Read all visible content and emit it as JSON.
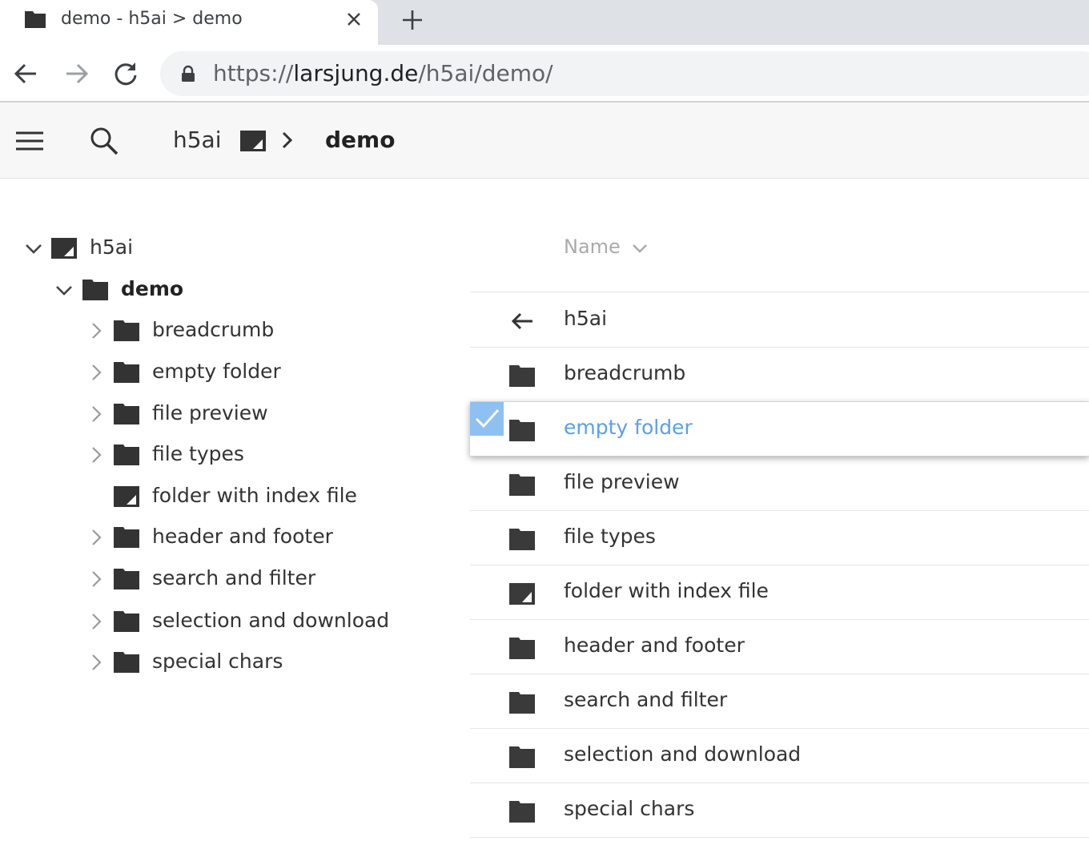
{
  "browser": {
    "tab_title": "demo - h5ai > demo",
    "url_scheme": "https://",
    "url_host": "larsjung.de",
    "url_path": "/h5ai/demo/"
  },
  "topbar": {
    "crumb_root": "h5ai",
    "crumb_current": "demo"
  },
  "tree": {
    "root": "h5ai",
    "current": "demo",
    "children": [
      {
        "label": "breadcrumb",
        "has_children": true,
        "icon": "folder-icon"
      },
      {
        "label": "empty folder",
        "has_children": true,
        "icon": "folder-icon"
      },
      {
        "label": "file preview",
        "has_children": true,
        "icon": "folder-icon"
      },
      {
        "label": "file types",
        "has_children": true,
        "icon": "folder-icon"
      },
      {
        "label": "folder with index file",
        "has_children": false,
        "icon": "folder-page-icon"
      },
      {
        "label": "header and footer",
        "has_children": true,
        "icon": "folder-icon"
      },
      {
        "label": "search and filter",
        "has_children": true,
        "icon": "folder-icon"
      },
      {
        "label": "selection and download",
        "has_children": true,
        "icon": "folder-icon"
      },
      {
        "label": "special chars",
        "has_children": true,
        "icon": "folder-icon"
      }
    ]
  },
  "list": {
    "header_name": "Name",
    "parent": "h5ai",
    "items": [
      {
        "label": "breadcrumb",
        "icon": "folder-icon",
        "selected": false
      },
      {
        "label": "empty folder",
        "icon": "folder-icon",
        "selected": true
      },
      {
        "label": "file preview",
        "icon": "folder-icon",
        "selected": false
      },
      {
        "label": "file types",
        "icon": "folder-icon",
        "selected": false
      },
      {
        "label": "folder with index file",
        "icon": "folder-page-icon",
        "selected": false
      },
      {
        "label": "header and footer",
        "icon": "folder-icon",
        "selected": false
      },
      {
        "label": "search and filter",
        "icon": "folder-icon",
        "selected": false
      },
      {
        "label": "selection and download",
        "icon": "folder-icon",
        "selected": false
      },
      {
        "label": "special chars",
        "icon": "folder-icon",
        "selected": false
      }
    ]
  },
  "colors": {
    "selected_text": "#5aa0ea",
    "selected_check": "#8ec0f2",
    "folder_icon": "#3a3a3a"
  }
}
